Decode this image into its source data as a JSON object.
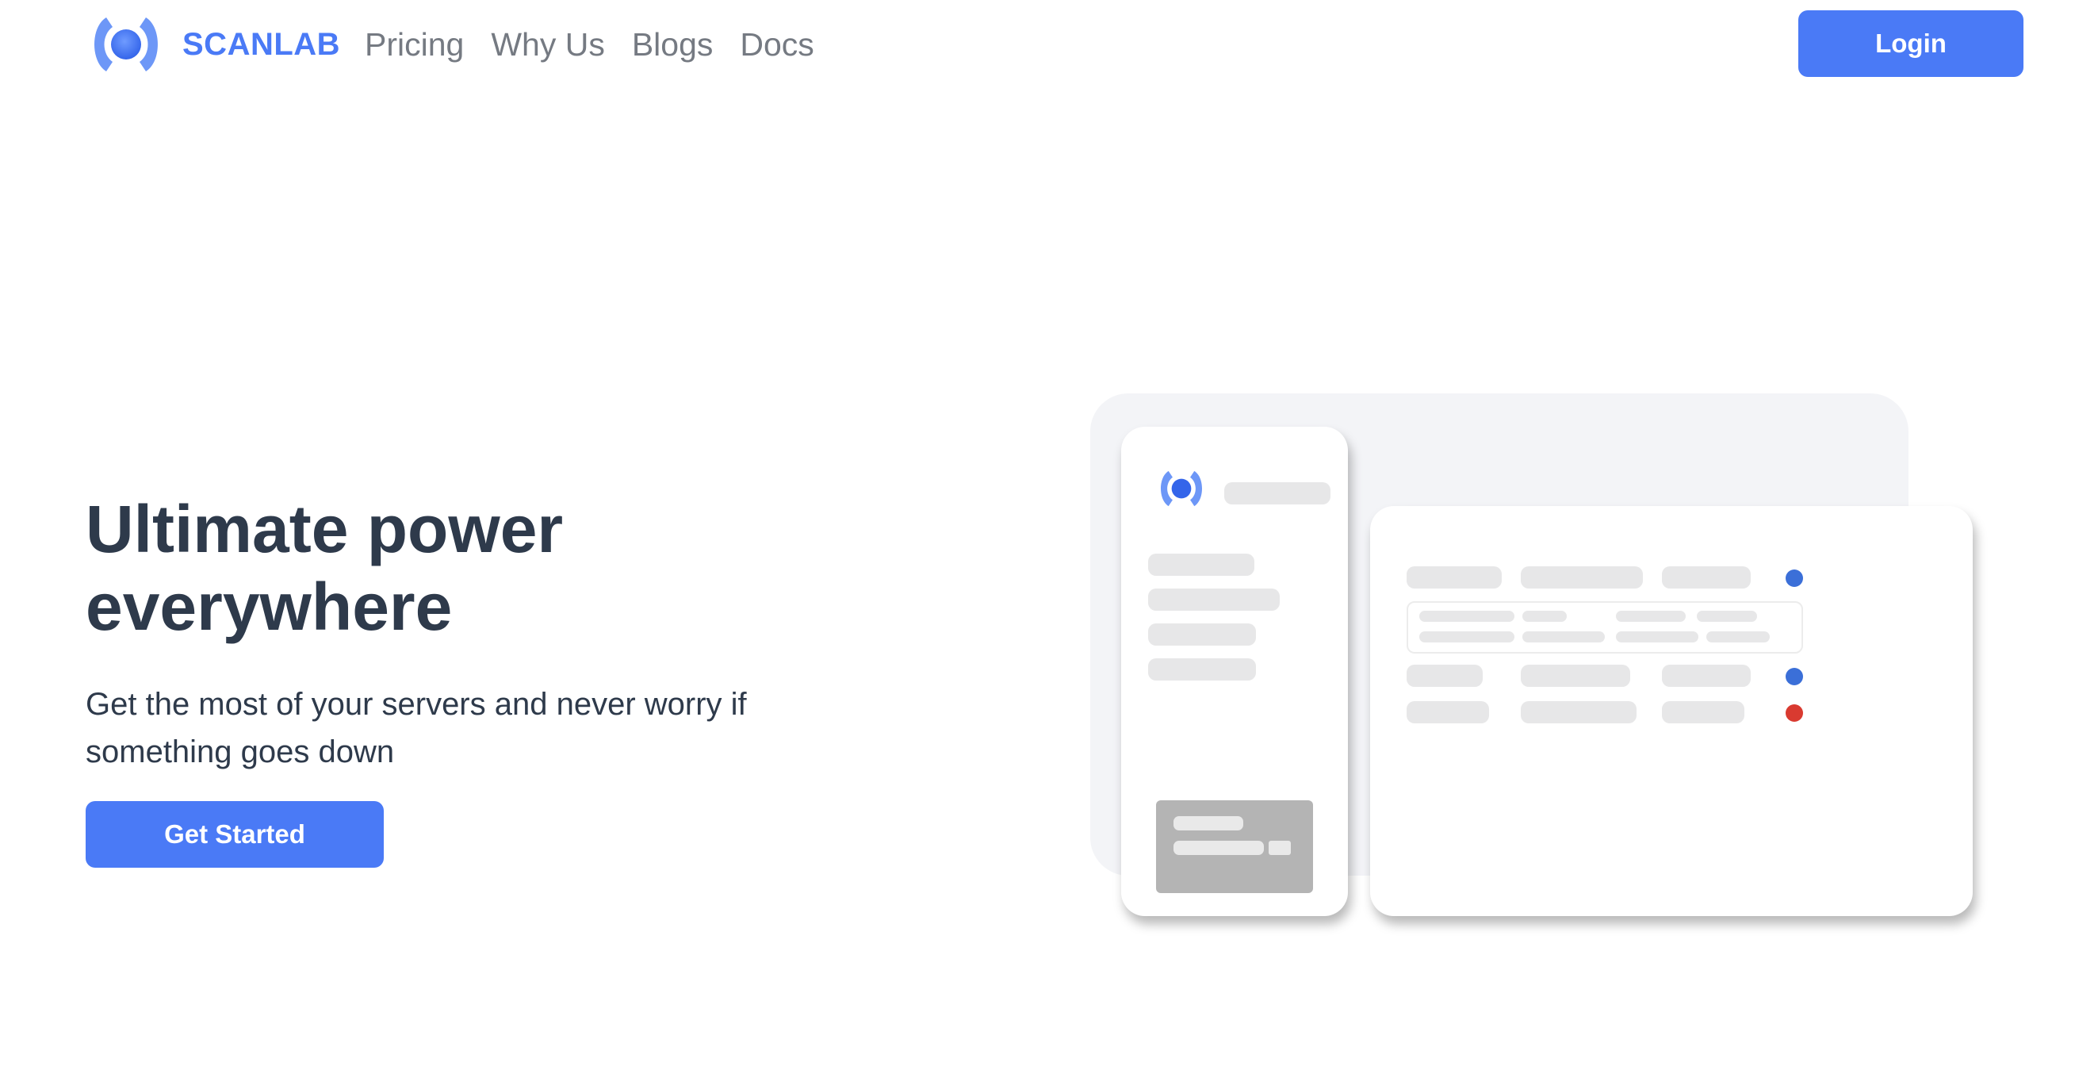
{
  "brand": {
    "name": "SCANLAB",
    "logo_icon": "scanlab-logo-icon",
    "accent_color": "#4a7af6"
  },
  "nav": {
    "items": [
      {
        "label": "Pricing"
      },
      {
        "label": "Why Us"
      },
      {
        "label": "Blogs"
      },
      {
        "label": "Docs"
      }
    ]
  },
  "header": {
    "login_label": "Login"
  },
  "hero": {
    "title": "Ultimate power everywhere",
    "subtitle": "Get the most of your servers and never worry if something goes down",
    "cta_label": "Get Started"
  },
  "illustration": {
    "status_colors": {
      "ok": "#3b6fd8",
      "down": "#d93a30"
    },
    "server_status": [
      "ok",
      "ok",
      "down"
    ]
  }
}
